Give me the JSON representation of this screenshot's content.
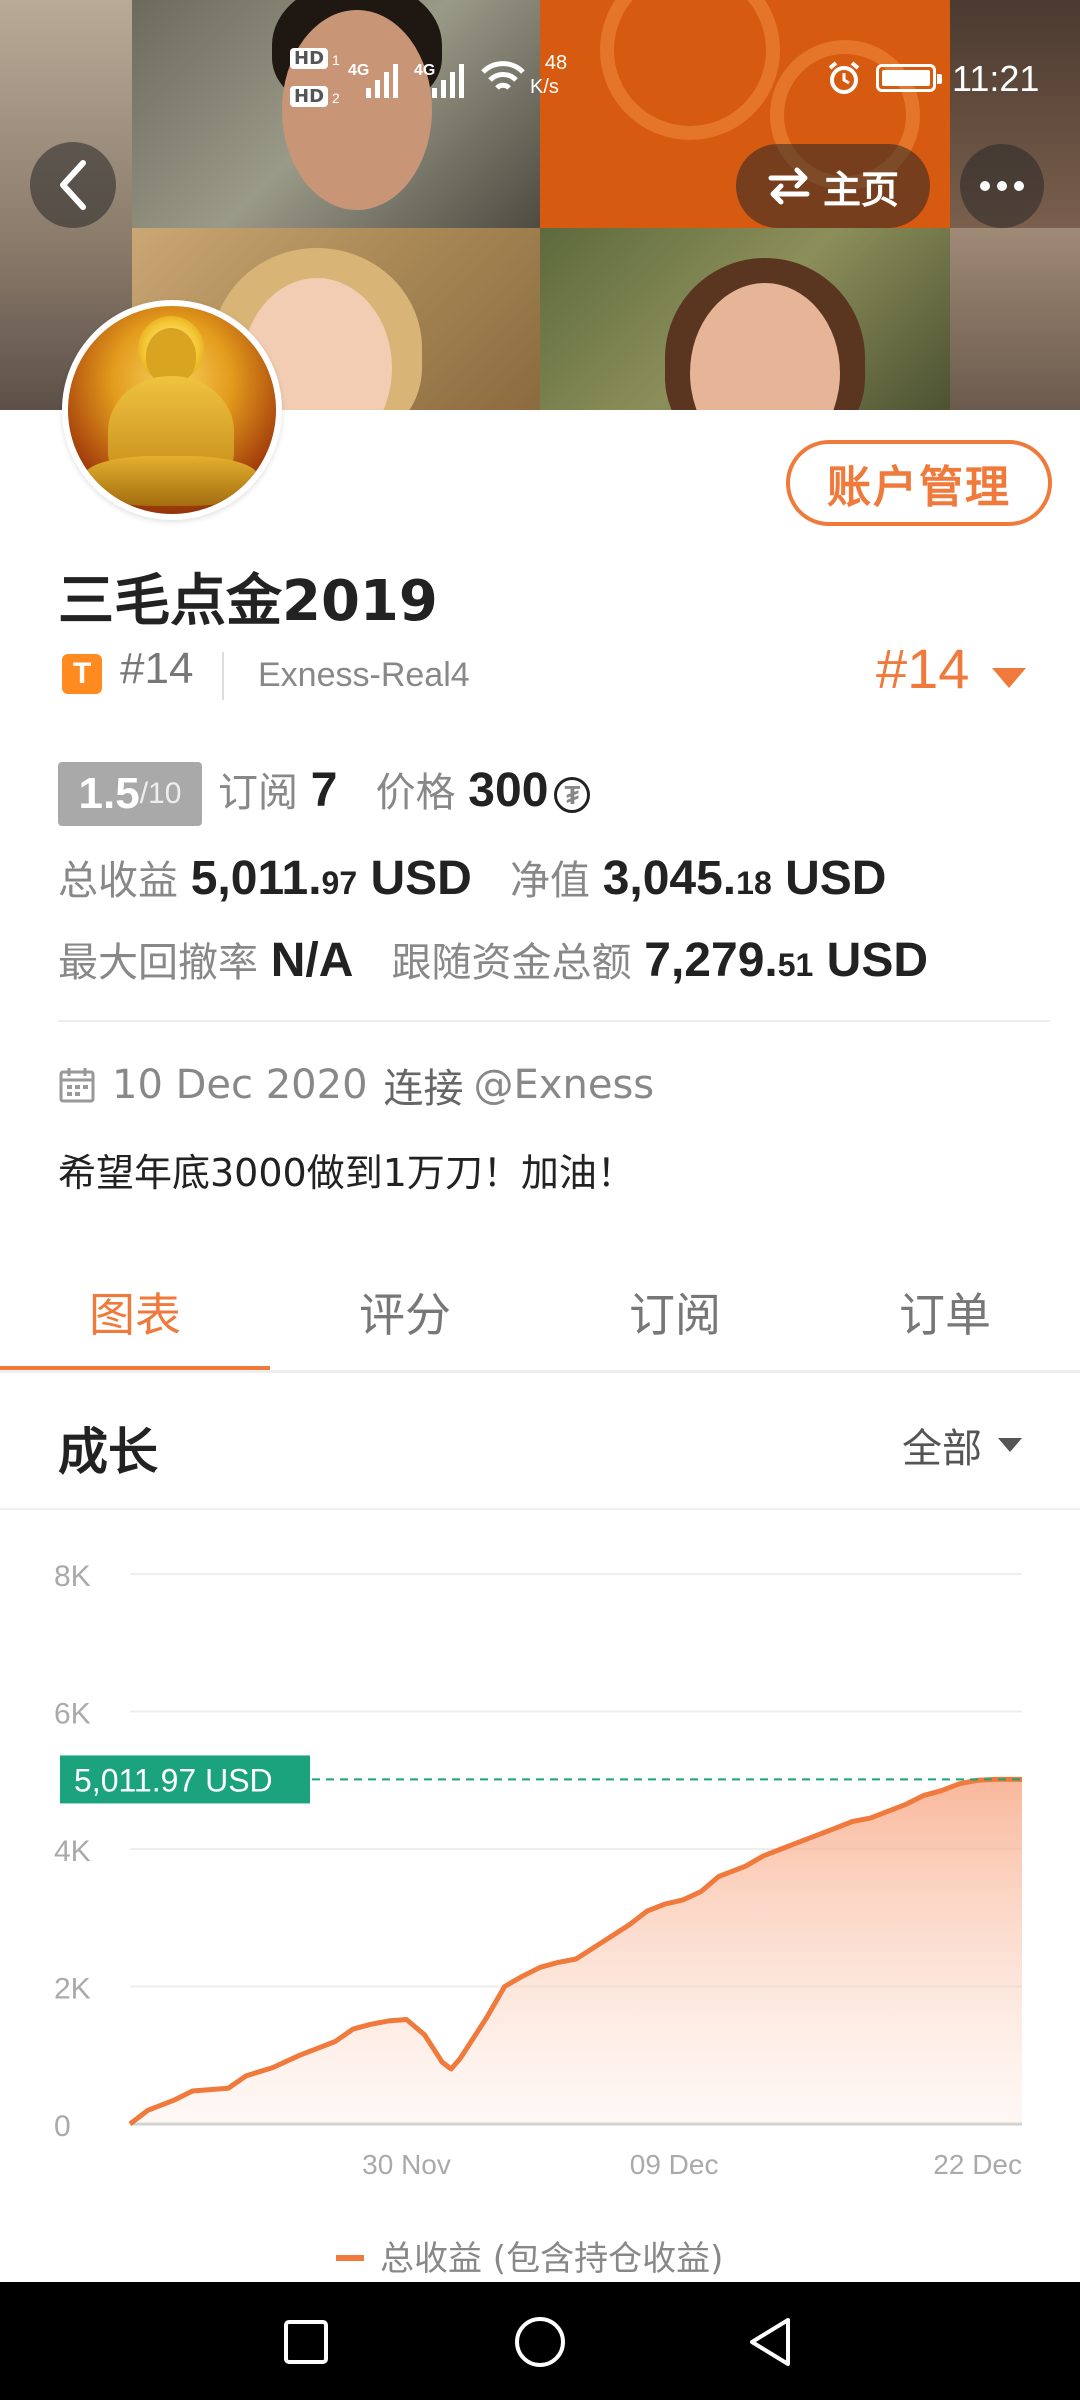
{
  "status_bar": {
    "hd1": "HD",
    "hd1_sub": "1",
    "hd2": "HD",
    "hd2_sub": "2",
    "net1": "4G",
    "net2": "4G",
    "speed_value": "48",
    "speed_unit": "K/s",
    "time": "11:21"
  },
  "header": {
    "home_label": "主页"
  },
  "profile": {
    "account_button": "账户管理",
    "name": "三毛点金2019",
    "badge": "T",
    "rank_small": "#14",
    "server": "Exness-Real4",
    "rank_big": "#14",
    "score_value": "1.5",
    "score_max": "/10",
    "subscribe_label": "订阅",
    "subscribe_count": "7",
    "price_label": "价格",
    "price_value": "300",
    "price_currency_symbol": "₮",
    "total_profit_label": "总收益",
    "total_profit_int": "5,011.",
    "total_profit_dec": "97",
    "total_profit_unit": "USD",
    "equity_label": "净值",
    "equity_int": "3,045.",
    "equity_dec": "18",
    "equity_unit": "USD",
    "drawdown_label": "最大回撤率",
    "drawdown_value": "N/A",
    "follow_label": "跟随资金总额",
    "follow_int": "7,279.",
    "follow_dec": "51",
    "follow_unit": "USD",
    "joined_date": "10 Dec 2020",
    "joined_connect": "连接",
    "joined_broker": "@Exness",
    "bio": "希望年底3000做到1万刀！加油！"
  },
  "tabs": [
    "图表",
    "评分",
    "订阅",
    "订单"
  ],
  "growth": {
    "title": "成长",
    "filter": "全部"
  },
  "colors": {
    "accent": "#f07a3c",
    "marker": "#1aa37c"
  },
  "chart_data": {
    "type": "area",
    "y_ticks": [
      "8K",
      "6K",
      "4K",
      "2K",
      "0"
    ],
    "ylim": [
      0,
      8000
    ],
    "x_ticks": [
      {
        "label": "30 Nov",
        "x": 0.31
      },
      {
        "label": "09 Dec",
        "x": 0.61
      },
      {
        "label": "22 Dec",
        "x": 1.0
      }
    ],
    "current_value_label": "5,011.97 USD",
    "current_value": 5011.97,
    "series": [
      {
        "name": "总收益 (包含持仓收益)",
        "x": [
          0,
          0.02,
          0.05,
          0.07,
          0.09,
          0.11,
          0.13,
          0.16,
          0.19,
          0.21,
          0.23,
          0.25,
          0.27,
          0.29,
          0.31,
          0.33,
          0.35,
          0.36,
          0.37,
          0.38,
          0.39,
          0.4,
          0.42,
          0.44,
          0.46,
          0.48,
          0.5,
          0.53,
          0.56,
          0.58,
          0.6,
          0.62,
          0.64,
          0.66,
          0.69,
          0.71,
          0.73,
          0.75,
          0.77,
          0.79,
          0.81,
          0.83,
          0.85,
          0.87,
          0.89,
          0.91,
          0.93,
          0.95,
          0.97,
          1.0
        ],
        "values": [
          0,
          200,
          350,
          480,
          500,
          520,
          700,
          820,
          1000,
          1100,
          1200,
          1380,
          1450,
          1500,
          1520,
          1300,
          900,
          800,
          950,
          1150,
          1350,
          1550,
          2000,
          2150,
          2280,
          2350,
          2400,
          2650,
          2900,
          3100,
          3200,
          3260,
          3380,
          3600,
          3750,
          3900,
          4000,
          4100,
          4200,
          4300,
          4400,
          4450,
          4550,
          4650,
          4780,
          4850,
          4950,
          5000,
          5011.97,
          5011.97
        ]
      }
    ],
    "grid": true,
    "legend_position": "bottom"
  }
}
